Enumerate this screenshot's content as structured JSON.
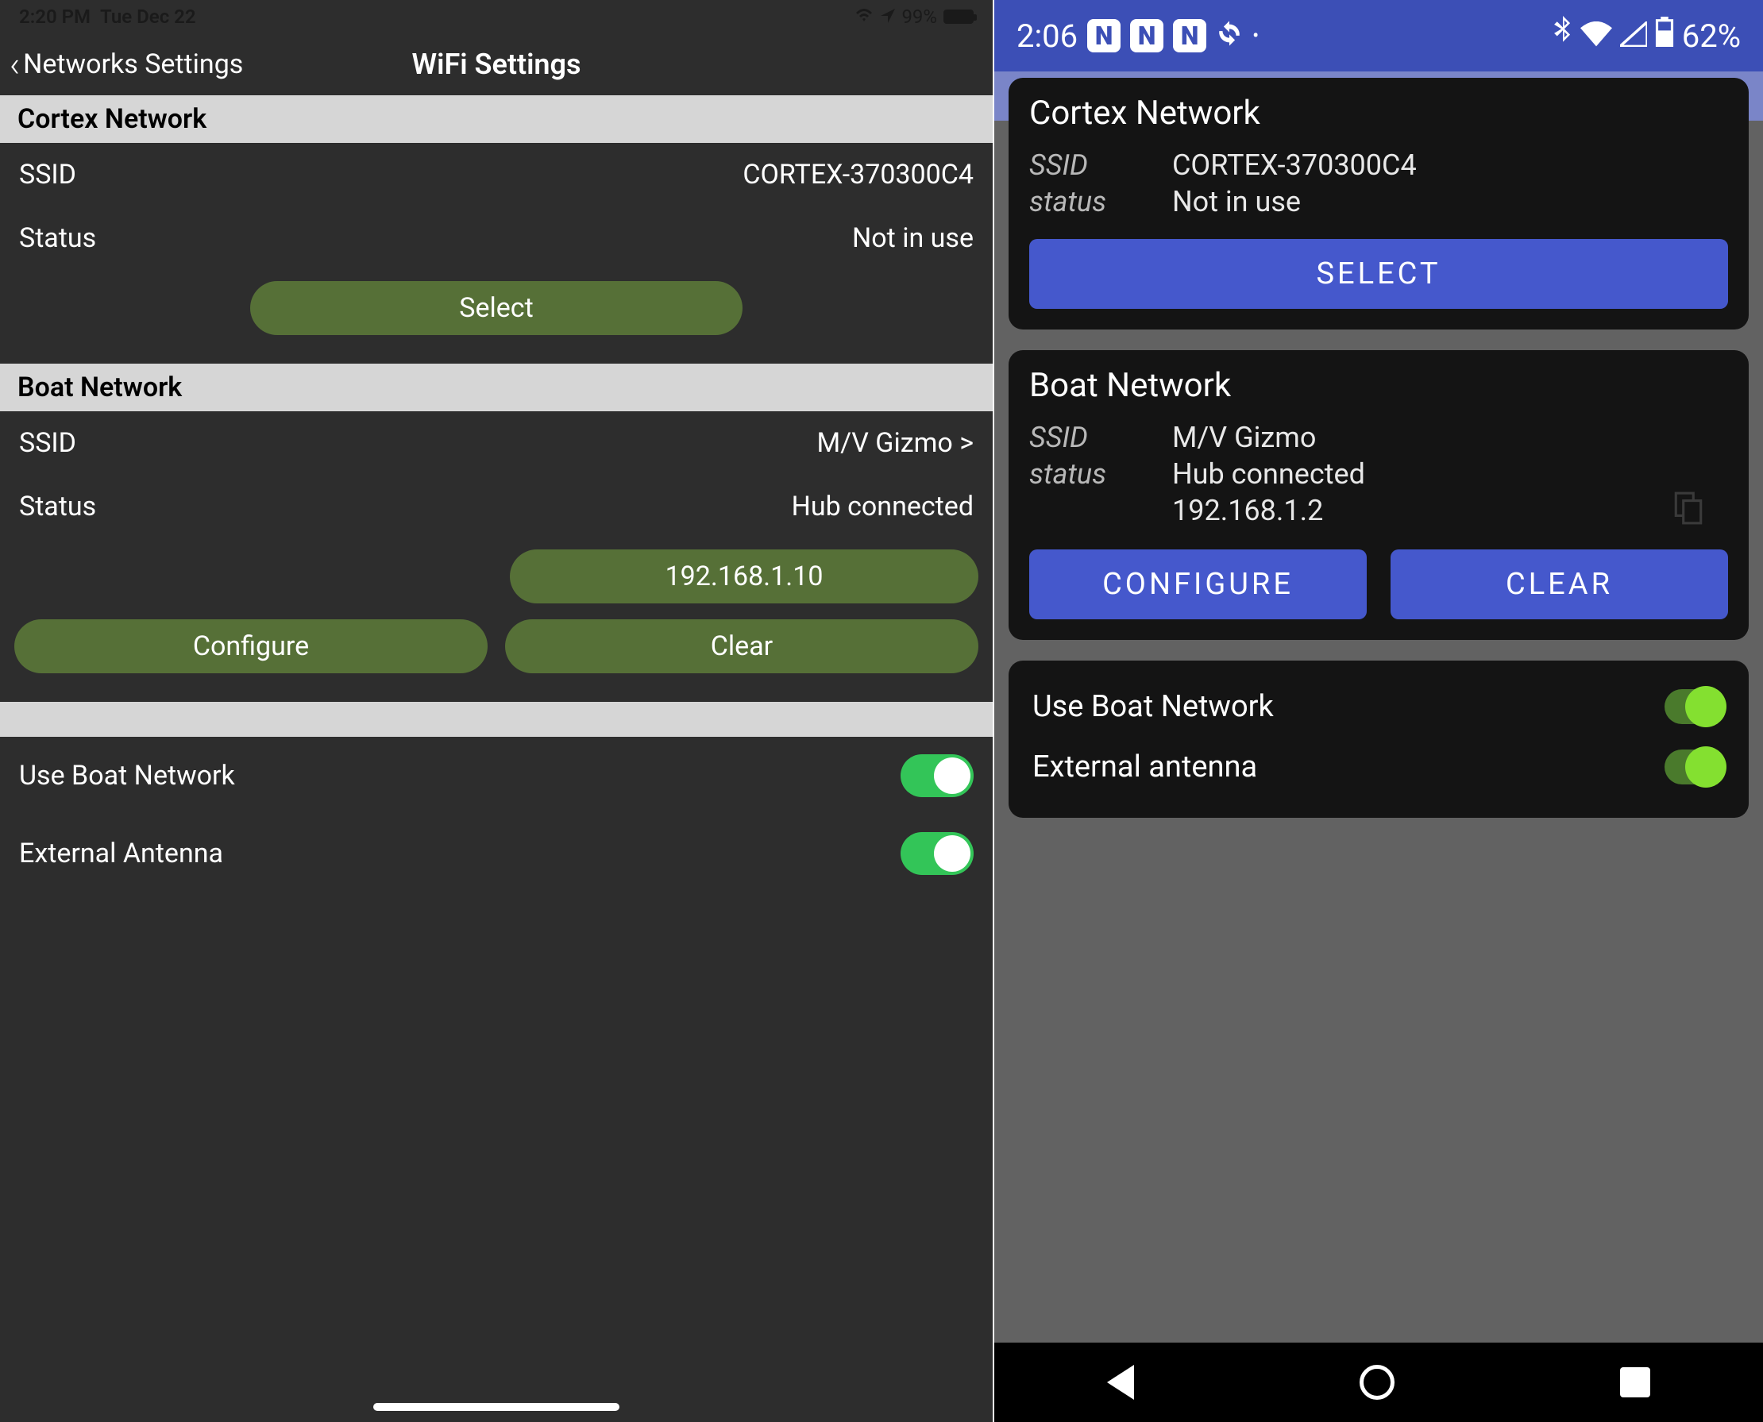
{
  "left": {
    "statusbar": {
      "time": "2:20 PM",
      "date": "Tue Dec 22",
      "battery": "99%"
    },
    "nav": {
      "back": "Networks Settings",
      "title": "WiFi Settings"
    },
    "cortex": {
      "header": "Cortex Network",
      "ssid_label": "SSID",
      "ssid_value": "CORTEX-370300C4",
      "status_label": "Status",
      "status_value": "Not in use",
      "select_btn": "Select"
    },
    "boat": {
      "header": "Boat Network",
      "ssid_label": "SSID",
      "ssid_value": "M/V Gizmo >",
      "status_label": "Status",
      "status_value": "Hub connected",
      "ip_btn": "192.168.1.10",
      "configure_btn": "Configure",
      "clear_btn": "Clear"
    },
    "toggles": {
      "use_boat": "Use Boat Network",
      "ext_antenna": "External Antenna"
    }
  },
  "right": {
    "statusbar": {
      "time": "2:06",
      "battery": "62%"
    },
    "cortex": {
      "header": "Cortex Network",
      "ssid_label": "SSID",
      "ssid_value": "CORTEX-370300C4",
      "status_label": "status",
      "status_value": "Not in use",
      "select_btn": "SELECT"
    },
    "boat": {
      "header": "Boat Network",
      "ssid_label": "SSID",
      "ssid_value": "M/V Gizmo",
      "status_label": "status",
      "status_value": "Hub connected",
      "ip_value": "192.168.1.2",
      "configure_btn": "CONFIGURE",
      "clear_btn": "CLEAR"
    },
    "toggles": {
      "use_boat": "Use Boat Network",
      "ext_antenna": "External antenna"
    }
  }
}
